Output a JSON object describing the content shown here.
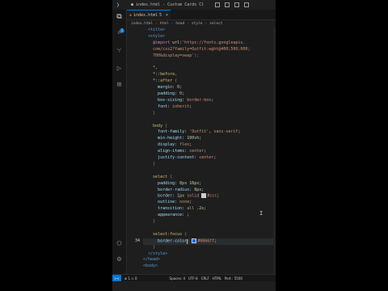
{
  "window": {
    "title": "● index.html - Custom Cards Cl...",
    "tab": {
      "label": "index.html",
      "modified_marker": "5",
      "close": "×"
    }
  },
  "breadcrumb": [
    "index.html",
    "html",
    "head",
    "style",
    "select"
  ],
  "activity_bar": {
    "items": [
      "explorer-icon",
      "search-icon",
      "source-control-icon",
      "run-debug-icon",
      "extensions-icon"
    ],
    "badge": "1",
    "bottom": [
      "account-icon",
      "settings-gear-icon"
    ]
  },
  "editor": {
    "line_numbers": [
      "",
      "",
      "",
      "",
      "",
      "",
      "",
      "",
      "",
      "",
      "",
      "",
      "",
      "",
      "",
      "",
      "",
      "",
      "",
      "",
      "",
      "",
      "",
      "",
      "",
      "",
      "",
      "",
      "",
      "",
      "",
      "",
      "",
      "34",
      "",
      "",
      "",
      "",
      "",
      ""
    ],
    "current_line": "34",
    "lines": [
      [
        [
          "t-tag",
          "  <title>"
        ]
      ],
      [
        [
          "t-tag",
          "  <style>"
        ]
      ],
      [
        [
          "t-at",
          "    @import "
        ],
        [
          "t-fn",
          "url"
        ],
        [
          "t-punc",
          "("
        ],
        [
          "t-str",
          "'https://fonts.googleapis."
        ]
      ],
      [
        [
          "t-str",
          "    com/css2?family=Outfit:wght@400;500;600;"
        ]
      ],
      [
        [
          "t-str",
          "    700&display=swap'"
        ],
        [
          "t-punc",
          ");"
        ]
      ],
      [
        [
          "t-plain",
          ""
        ]
      ],
      [
        [
          "t-sel",
          "    *,"
        ]
      ],
      [
        [
          "t-sel",
          "    *::before,"
        ]
      ],
      [
        [
          "t-sel",
          "    *::after "
        ],
        [
          "t-punc",
          "{"
        ]
      ],
      [
        [
          "t-prop",
          "      margin"
        ],
        [
          "t-plain",
          ": "
        ],
        [
          "t-num",
          "0"
        ],
        [
          "t-plain",
          ";"
        ]
      ],
      [
        [
          "t-prop",
          "      padding"
        ],
        [
          "t-plain",
          ": "
        ],
        [
          "t-num",
          "0"
        ],
        [
          "t-plain",
          ";"
        ]
      ],
      [
        [
          "t-prop",
          "      box-sizing"
        ],
        [
          "t-plain",
          ": "
        ],
        [
          "t-val",
          "border-box"
        ],
        [
          "t-plain",
          ";"
        ]
      ],
      [
        [
          "t-prop",
          "      font"
        ],
        [
          "t-plain",
          ": "
        ],
        [
          "t-val",
          "inherit"
        ],
        [
          "t-plain",
          ";"
        ]
      ],
      [
        [
          "t-punc",
          "    }"
        ]
      ],
      [
        [
          "t-plain",
          ""
        ]
      ],
      [
        [
          "t-sel",
          "    body "
        ],
        [
          "t-punc",
          "{"
        ]
      ],
      [
        [
          "t-prop",
          "      font-family"
        ],
        [
          "t-plain",
          ": "
        ],
        [
          "t-str",
          "'Outfit'"
        ],
        [
          "t-plain",
          ", "
        ],
        [
          "t-val",
          "sans-serif"
        ],
        [
          "t-plain",
          ";"
        ]
      ],
      [
        [
          "t-prop",
          "      min-height"
        ],
        [
          "t-plain",
          ": "
        ],
        [
          "t-num",
          "100vh"
        ],
        [
          "t-plain",
          ";"
        ]
      ],
      [
        [
          "t-prop",
          "      display"
        ],
        [
          "t-plain",
          ": "
        ],
        [
          "t-val",
          "flex"
        ],
        [
          "t-plain",
          ";"
        ]
      ],
      [
        [
          "t-prop",
          "      align-items"
        ],
        [
          "t-plain",
          ": "
        ],
        [
          "t-val",
          "center"
        ],
        [
          "t-plain",
          ";"
        ]
      ],
      [
        [
          "t-prop",
          "      justify-content"
        ],
        [
          "t-plain",
          ": "
        ],
        [
          "t-val",
          "center"
        ],
        [
          "t-plain",
          ";"
        ]
      ],
      [
        [
          "t-punc",
          "    }"
        ]
      ],
      [
        [
          "t-plain",
          ""
        ]
      ],
      [
        [
          "t-sel",
          "    select "
        ],
        [
          "t-punc",
          "{"
        ]
      ],
      [
        [
          "t-prop",
          "      padding"
        ],
        [
          "t-plain",
          ": "
        ],
        [
          "t-num",
          "8px 16px"
        ],
        [
          "t-plain",
          ";"
        ]
      ],
      [
        [
          "t-prop",
          "      border-radius"
        ],
        [
          "t-plain",
          ": "
        ],
        [
          "t-num",
          "8px"
        ],
        [
          "t-plain",
          ";"
        ]
      ],
      [
        [
          "t-prop",
          "      border"
        ],
        [
          "t-plain",
          ": "
        ],
        [
          "t-num",
          "1px"
        ],
        [
          "t-val",
          " solid "
        ],
        [
          "swatch",
          "#ccc"
        ],
        [
          "t-val",
          "#ccc"
        ],
        [
          "t-plain",
          ";"
        ]
      ],
      [
        [
          "t-prop",
          "      outline"
        ],
        [
          "t-plain",
          ": "
        ],
        [
          "t-val",
          "none"
        ],
        [
          "t-plain",
          ";"
        ]
      ],
      [
        [
          "t-prop",
          "      transition"
        ],
        [
          "t-plain",
          ": "
        ],
        [
          "t-val",
          "all "
        ],
        [
          "t-num",
          ".2s"
        ],
        [
          "t-plain",
          ";"
        ]
      ],
      [
        [
          "t-prop",
          "      appearance"
        ],
        [
          "t-plain",
          ": ;"
        ]
      ],
      [
        [
          "t-punc",
          "    }"
        ]
      ],
      [
        [
          "t-plain",
          ""
        ]
      ],
      [
        [
          "t-sel",
          "    select:focus "
        ],
        [
          "t-punc",
          "{"
        ]
      ],
      [
        [
          "t-prop",
          "      border-color"
        ],
        [
          "t-plain",
          ": "
        ],
        [
          "swatch",
          "#0066ff"
        ],
        [
          "t-val",
          "#0066ff"
        ],
        [
          "t-plain",
          ";"
        ]
      ],
      [
        [
          "t-punc",
          "    }"
        ]
      ],
      [
        [
          "t-tag",
          "  </style>"
        ]
      ],
      [
        [
          "t-tag",
          "</head>"
        ]
      ],
      [
        [
          "t-tag",
          "<body>"
        ]
      ]
    ],
    "cursor_after": "appearance: "
  },
  "status_bar": {
    "remote": "><",
    "problems": "⊗ 1 ⚠ 0",
    "spaces": "Spaces: 4",
    "encoding": "UTF-8",
    "eol": "CRLF",
    "language": "HTML",
    "port": "Port : 5500"
  }
}
